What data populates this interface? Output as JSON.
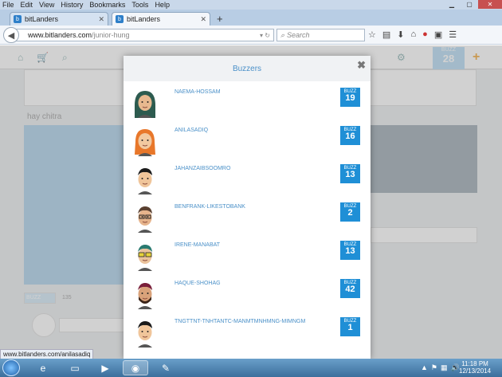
{
  "menu": [
    "File",
    "Edit",
    "View",
    "History",
    "Bookmarks",
    "Tools",
    "Help"
  ],
  "tabs": [
    {
      "label": "bitLanders",
      "active": false
    },
    {
      "label": "bitLanders",
      "active": true
    }
  ],
  "url": {
    "domain": "www.bitlanders.com",
    "path": "/junior-hung"
  },
  "search_placeholder": "Search",
  "site": {
    "buzz_label": "BUZZ",
    "buzz_count": "28",
    "bg_heading": "hay chitra",
    "bg_buzz": "BUZZ",
    "bg_count": "135"
  },
  "modal": {
    "title": "Buzzers",
    "badge_label": "BUZZ",
    "buzzers": [
      {
        "name": "NAEMA-HOSSAM",
        "count": "19",
        "hair": "#2d5b4f",
        "skin": "#e8b98f",
        "style": "hijab"
      },
      {
        "name": "ANILASADIQ",
        "count": "16",
        "hair": "#e8772a",
        "skin": "#f2c9a0",
        "style": "long"
      },
      {
        "name": "JAHANZAIBSOOMRO",
        "count": "13",
        "hair": "#1a1a1a",
        "skin": "#f0c59a",
        "style": "short"
      },
      {
        "name": "BENFRANK-LIKESTOBANK",
        "count": "2",
        "hair": "#5a4030",
        "skin": "#e6b48c",
        "style": "glasses"
      },
      {
        "name": "IRENE-MANABAT",
        "count": "13",
        "hair": "#2a7a70",
        "skin": "#eac39c",
        "style": "yellowglasses"
      },
      {
        "name": "HAQUE-SHOHAG",
        "count": "42",
        "hair": "#7a1f3a",
        "skin": "#d9a27a",
        "style": "beard"
      },
      {
        "name": "TNGTTNT-TNHTANTC-MANMTMNHMNG-MIMNGM",
        "count": "1",
        "hair": "#1a1a1a",
        "skin": "#f0c59a",
        "style": "short"
      }
    ]
  },
  "status_url": "www.bitlanders.com/anilasadiq",
  "clock": {
    "time": "11:18 PM",
    "date": "12/13/2014"
  }
}
